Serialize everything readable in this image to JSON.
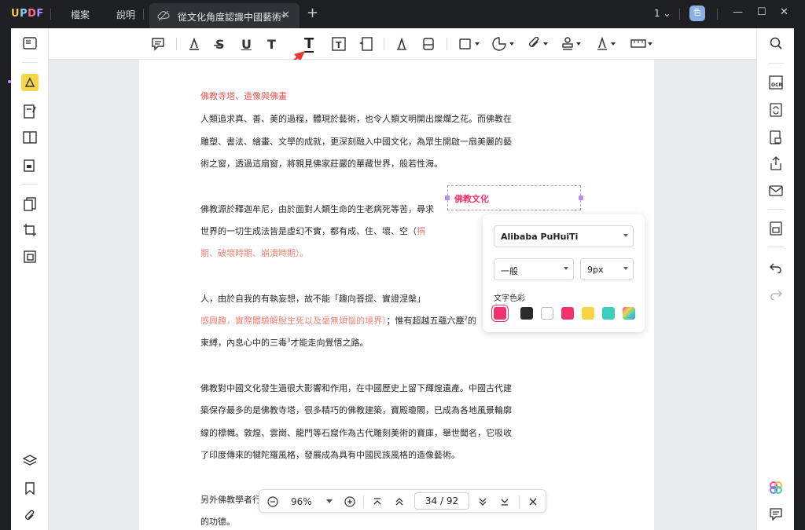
{
  "app": {
    "logo": "UPDF",
    "menu": [
      "檔案",
      "說明"
    ],
    "tab_title": "從文化角度認識中國藝術*",
    "tab_close": "✕",
    "new_tab": "+",
    "page_indicator": "1",
    "avatar_initial": "色"
  },
  "document": {
    "heading": "佛教寺塔、造像與佛畫",
    "p1": [
      "人類追求真、善、美的過程，體現於藝術，也令人類文明開出燦爛之花。而佛教在",
      "雕塑、書法、繪畫、文學的成就，更深刻融入中國文化，為眾生開啟一扇美麗的藝",
      "術之窗，透過這扇窗，將親見佛家莊嚴的華藏世界，般若性海。"
    ],
    "p2": [
      "佛教源於釋迦牟尼，由於面對人類生命的生老病死等苦，尋求",
      "世界的一切生成法皆是虛幻不實，都有成、住、壞、空（",
      "期、破壞時期、崩潰時期）。"
    ],
    "p2_red_1": "捐",
    "p3_1": "人，由於自我的有執妄想，故不能「趣向菩提、實證涅槃」",
    "p3_2_pink": "感興趣，實際體驗解脫生死以及毫無煩惱的境界）",
    "p3_2_rest": "；惟有超越五蘊六塵",
    "p3_2_sup": "2",
    "p3_2_end": "的",
    "p3_3_a": "束縛，內息心中的三毒",
    "p3_3_sup": "3",
    "p3_3_b": "才能走向覺悟之路。",
    "p4": [
      "佛教對中國文化發生過很大影響和作用，在中國歷史上留下輝煌遺產。中國古代建",
      "築保存最多的是佛教寺塔，很多精巧的佛教建築，寶殿瓊閣，已成為各地風景輪廓",
      "線的標幟。敦煌、雲崗、龍門等石窟作為古代雕刻美術的寶庫，舉世聞名，它吸收",
      "了印度傳來的犍陀羅風格，發展成為具有中國民族風格的造像藝術。"
    ],
    "p5": [
      "另外佛教學者行",
      "的功德。"
    ]
  },
  "textbox": {
    "text": "佛教文化"
  },
  "popover": {
    "font": "Alibaba PuHuiTi",
    "weight": "一般",
    "size": "9px",
    "color_label": "文字色彩",
    "colors": [
      "#f0336b",
      "#2b2b2b",
      "#ffffff",
      "#f0336b",
      "#f7d448",
      "#3ccfc0",
      "gradient"
    ]
  },
  "navbar": {
    "zoom": "96%",
    "page_current": "34",
    "page_total": "92",
    "page_display": "34 / 92"
  },
  "colors": {
    "accent": "#b491f0",
    "highlight_tool": "#f7d448",
    "arrow": "#e53935"
  }
}
